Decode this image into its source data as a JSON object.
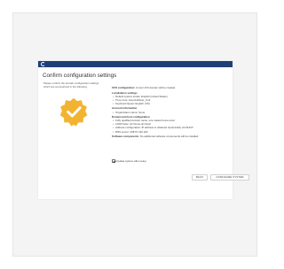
{
  "dialog": {
    "title": "Confirm configuration settings",
    "intro": "Please confirm the domain configuration settings which are summarized in the following.",
    "accent_color": "#1f3f77",
    "badge_color": "#f2b430",
    "badge_icon": "check-badge-icon"
  },
  "summary": {
    "ucs_label": "UCS configuration",
    "ucs_text": ": A new UCS domain will be created.",
    "localization_heading": "Localization settings",
    "localization_items": [
      "Default system locale: English (United States)",
      "Time zone: America/New_York",
      "Keyboard layout: English (US)"
    ],
    "account_heading": "Account information",
    "account_items": [
      "Organization name: home"
    ],
    "domain_heading": "Domain and host configuration",
    "domain_items": [
      "Fully qualified domain name: ucs-master.home.local",
      "LDAP base: dc=home,dc=local",
      "Address configuration: IP address is obtained dynamically via DHCP",
      "DNS server: 208.67.222.222"
    ],
    "software_label": "Software components",
    "software_text": ": No additional software components will be installed."
  },
  "update_checkbox": {
    "label": "Update system after setup",
    "checked": true
  },
  "buttons": {
    "back": "BACK",
    "configure": "CONFIGURE SYSTEM"
  }
}
